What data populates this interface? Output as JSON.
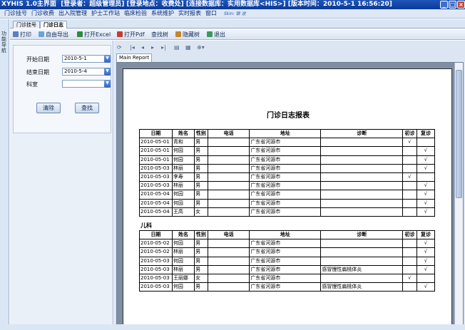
{
  "app": {
    "title": "XYHIS 1.0主界面",
    "info": "[登录者：超级管理员] [登录地点：收费处] [连接数据库：实用数据库<HIS>] [版本时间：2010-5-1 16:56:20]"
  },
  "menu": [
    "门诊挂号",
    "门诊收费",
    "出入院管理",
    "护士工作站",
    "临床检验",
    "系统维护",
    "实时报表",
    "窗口"
  ],
  "skin": "Skin: 银 波",
  "left_strip": "功能导航",
  "tabs": [
    "门诊挂号",
    "门诊日志"
  ],
  "toolbar": [
    "打印",
    "自由导出",
    "打开Excel",
    "打开Pdf",
    "查找树",
    "隐藏树",
    "退出"
  ],
  "filter": {
    "start_label": "开始日期",
    "start_value": "2010-5-1",
    "end_label": "结束日期",
    "end_value": "2010-5-4",
    "dept_label": "科室",
    "dept_value": "",
    "clear": "清除",
    "search": "查找"
  },
  "report_tab": "Main Report",
  "report": {
    "title": "门诊日志报表",
    "headers": [
      "日期",
      "姓名",
      "性别",
      "电话",
      "地址",
      "诊断",
      "初诊",
      "复诊"
    ],
    "section1": [
      [
        "2010-05-01",
        "青和",
        "男",
        "",
        "广东省河源市",
        "",
        "√",
        ""
      ],
      [
        "2010-05-01",
        "何园",
        "男",
        "",
        "广东省河源市",
        "",
        "",
        "√"
      ],
      [
        "2010-05-01",
        "何园",
        "男",
        "",
        "广东省河源市",
        "",
        "",
        "√"
      ],
      [
        "2010-05-03",
        "林丽",
        "男",
        "",
        "广东省河源市",
        "",
        "",
        "√"
      ],
      [
        "2010-05-03",
        "李寿",
        "男",
        "",
        "广东省河源市",
        "",
        "√",
        ""
      ],
      [
        "2010-05-03",
        "林丽",
        "男",
        "",
        "广东省河源市",
        "",
        "",
        "√"
      ],
      [
        "2010-05-04",
        "何园",
        "男",
        "",
        "广东省河源市",
        "",
        "",
        "√"
      ],
      [
        "2010-05-04",
        "何园",
        "男",
        "",
        "广东省河源市",
        "",
        "",
        "√"
      ],
      [
        "2010-05-04",
        "王高",
        "女",
        "",
        "广东省河源市",
        "",
        "",
        "√"
      ]
    ],
    "section2_name": "儿科",
    "section2": [
      [
        "2010-05-02",
        "何园",
        "男",
        "",
        "广东省河源市",
        "",
        "",
        "√"
      ],
      [
        "2010-05-02",
        "林丽",
        "男",
        "",
        "广东省河源市",
        "",
        "",
        "√"
      ],
      [
        "2010-05-03",
        "何园",
        "男",
        "",
        "广东省河源市",
        "",
        "",
        "√"
      ],
      [
        "2010-05-03",
        "林丽",
        "男",
        "",
        "广东省河源市",
        "感冒慢性扁桃体炎",
        "",
        "√"
      ],
      [
        "2010-05-03",
        "王丽娜",
        "女",
        "",
        "广东省河源市",
        "",
        "√",
        ""
      ],
      [
        "2010-05-03",
        "何园",
        "男",
        "",
        "广东省河源市",
        "感冒慢性扁桃体炎",
        "",
        "√"
      ]
    ]
  }
}
